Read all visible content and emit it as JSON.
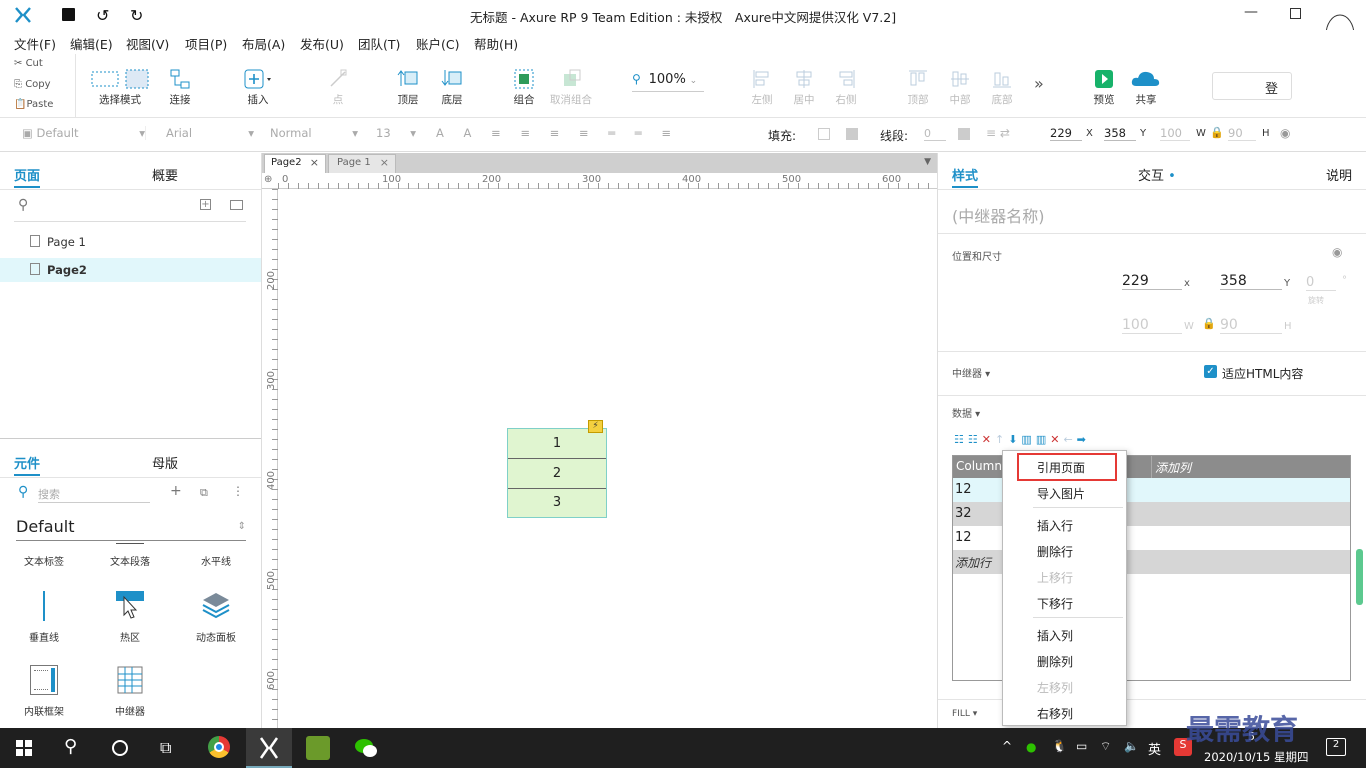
{
  "title": "无标题 - Axure RP 9 Team Edition : 未授权　Axure中文网提供汉化 V7.2]",
  "menu": [
    "文件(F)",
    "编辑(E)",
    "视图(V)",
    "项目(P)",
    "布局(A)",
    "发布(U)",
    "团队(T)",
    "账户(C)",
    "帮助(H)"
  ],
  "clipboard": {
    "cut": "Cut",
    "copy": "Copy",
    "paste": "Paste"
  },
  "toolbar": {
    "select_mode": "选择模式",
    "connect": "连接",
    "insert": "插入",
    "point": "点",
    "top": "顶层",
    "bottom": "底层",
    "group": "组合",
    "ungroup": "取消组合",
    "zoom": "100%",
    "left": "左侧",
    "center": "居中",
    "right": "右侧",
    "top_align": "顶部",
    "middle": "中部",
    "bottom_align": "底部",
    "preview": "预览",
    "share": "共享",
    "login": "登"
  },
  "format": {
    "style": "Default",
    "font": "Arial",
    "weight": "Normal",
    "size": "13",
    "fill": "填充:",
    "line": "线段:",
    "line_val": "0",
    "x": "229",
    "x_lbl": "X",
    "y": "358",
    "y_lbl": "Y",
    "w": "100",
    "w_lbl": "W",
    "h": "90",
    "h_lbl": "H"
  },
  "left": {
    "tab_pages": "页面",
    "tab_outline": "概要",
    "pages": [
      "Page 1",
      "Page2"
    ],
    "tab_widgets": "元件",
    "tab_masters": "母版",
    "search_placeholder": "搜索",
    "library": "Default",
    "widgets": [
      "文本标签",
      "文本段落",
      "水平线",
      "垂直线",
      "热区",
      "动态面板",
      "内联框架",
      "中继器"
    ]
  },
  "canvas": {
    "tabs": [
      "Page2",
      "Page 1"
    ],
    "ruler_h": [
      "0",
      "100",
      "200",
      "300",
      "400",
      "500",
      "600"
    ],
    "ruler_v": [
      "200",
      "300",
      "400",
      "500",
      "600"
    ],
    "repeater_rows": [
      "1",
      "2",
      "3"
    ]
  },
  "right": {
    "tab_style": "样式",
    "tab_interact": "交互",
    "tab_notes": "说明",
    "name_placeholder": "(中继器名称)",
    "pos_size": "位置和尺寸",
    "x": "229",
    "x_lbl": "x",
    "y": "358",
    "y_lbl": "Y",
    "rot": "0",
    "rot_unit": "°",
    "rot_lbl": "旋转",
    "w": "100",
    "w_lbl": "W",
    "h": "90",
    "h_lbl": "H",
    "repeater": "中继器",
    "fit_html": "适应HTML内容",
    "data": "数据",
    "col_header": "Column",
    "add_col": "添加列",
    "rows": [
      "12",
      "32",
      "12"
    ],
    "add_row": "添加行",
    "fill": "FILL"
  },
  "context_menu": [
    "引用页面",
    "导入图片",
    "插入行",
    "删除行",
    "上移行",
    "下移行",
    "插入列",
    "删除列",
    "左移列",
    "右移列"
  ],
  "watermark": "最需教育",
  "taskbar": {
    "lang": "英",
    "datetime": "2020/10/15 星期四",
    "notif": "2",
    "time_partial": "5"
  },
  "colors": {
    "accent": "#1e90c8",
    "repeater_fill": "#e0f5d0",
    "selected_page": "#e1f7fb",
    "highlight": "#e53935"
  }
}
